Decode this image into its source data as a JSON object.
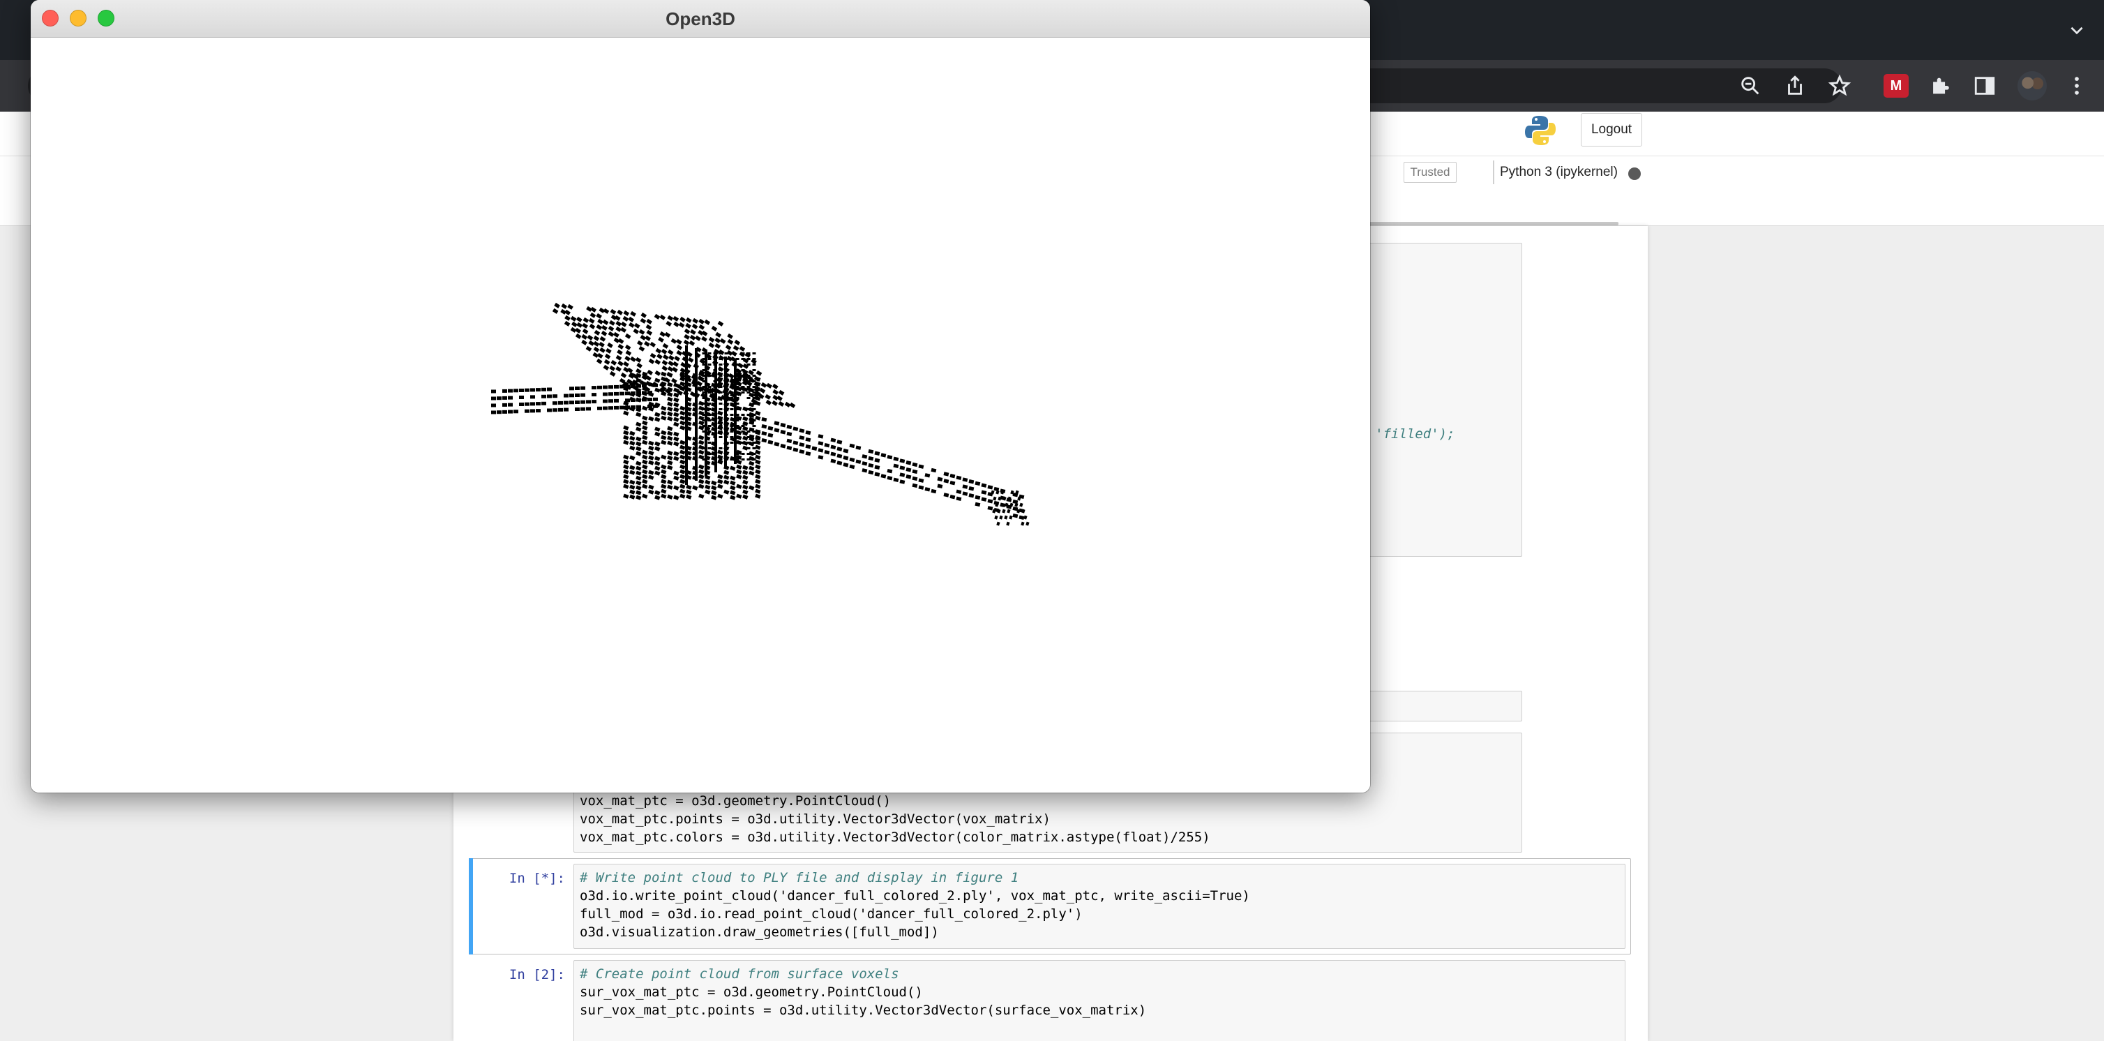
{
  "browser": {
    "extension_label": "M"
  },
  "jupyter": {
    "logout_label": "Logout",
    "trusted_label": "Trusted",
    "kernel_name": "Python 3 (ipykernel)",
    "partial_code_line": "color_matrix, 'filled');",
    "cells": [
      {
        "prompt": "",
        "lines": [
          "vox_mat_ptc = o3d.geometry.PointCloud()",
          "vox_mat_ptc.points = o3d.utility.Vector3dVector(vox_matrix)",
          "vox_mat_ptc.colors = o3d.utility.Vector3dVector(color_matrix.astype(float)/255)"
        ]
      },
      {
        "prompt": "In [*]:",
        "lines": [
          "# Write point cloud to PLY file and display in figure 1",
          "o3d.io.write_point_cloud('dancer_full_colored_2.ply', vox_mat_ptc, write_ascii=True)",
          "full_mod = o3d.io.read_point_cloud('dancer_full_colored_2.ply')",
          "o3d.visualization.draw_geometries([full_mod])"
        ]
      },
      {
        "prompt": "In [2]:",
        "lines": [
          "# Create point cloud from surface voxels",
          "sur_vox_mat_ptc = o3d.geometry.PointCloud()",
          "sur_vox_mat_ptc.points = o3d.utility.Vector3dVector(surface_vox_matrix)"
        ]
      }
    ]
  },
  "open3d_window": {
    "title": "Open3D"
  },
  "colors": {
    "selected_cell_accent": "#42a5f5",
    "prompt_color": "#303f9f",
    "point_color": "#000000"
  }
}
